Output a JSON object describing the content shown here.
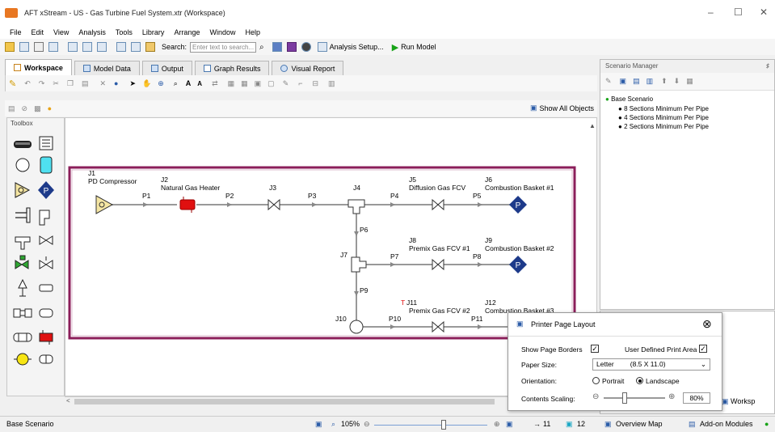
{
  "window": {
    "title": "AFT xStream - US - Gas Turbine Fuel System.xtr (Workspace)",
    "minimize": "–",
    "maximize": "☐",
    "close": "✕"
  },
  "menu": [
    "File",
    "Edit",
    "View",
    "Analysis",
    "Tools",
    "Library",
    "Arrange",
    "Window",
    "Help"
  ],
  "toolbar": {
    "search_label": "Search:",
    "search_placeholder": "Enter text to search...",
    "analysis_setup": "Analysis Setup...",
    "run_model": "Run Model"
  },
  "tabs": [
    "Workspace",
    "Model Data",
    "Output",
    "Graph Results",
    "Visual Report"
  ],
  "workspace": {
    "show_all": "Show All Objects",
    "toolbox_label": "Toolbox"
  },
  "model": {
    "junctions": {
      "j1": {
        "id": "J1",
        "name": "PD Compressor"
      },
      "j2": {
        "id": "J2",
        "name": "Natural Gas Heater"
      },
      "j3": {
        "id": "J3"
      },
      "j4": {
        "id": "J4"
      },
      "j5": {
        "id": "J5",
        "name": "Diffusion Gas FCV"
      },
      "j6": {
        "id": "J6",
        "name": "Combustion Basket #1"
      },
      "j7": {
        "id": "J7"
      },
      "j8": {
        "id": "J8",
        "name": "Premix Gas FCV #1"
      },
      "j9": {
        "id": "J9",
        "name": "Combustion Basket #2"
      },
      "j10": {
        "id": "J10"
      },
      "j11": {
        "id": "J11",
        "name": "Premix Gas FCV #2"
      },
      "j12": {
        "id": "J12",
        "name": "Combustion Basket #3"
      }
    },
    "pipes": [
      "P1",
      "P2",
      "P3",
      "P4",
      "P5",
      "P6",
      "P7",
      "P8",
      "P9",
      "P10",
      "P11"
    ],
    "pump_symbol": "P",
    "warn_marker": "T"
  },
  "scenario": {
    "header": "Scenario Manager",
    "pin": "♯",
    "base": "Base Scenario",
    "children": [
      "8 Sections Minimum Per Pipe",
      "4 Sections Minimum Per Pipe",
      "2 Sections Minimum Per Pipe"
    ]
  },
  "printer": {
    "title": "Printer Page Layout",
    "show_borders": "Show Page Borders",
    "user_defined": "User Defined Print Area",
    "paper_size_label": "Paper Size:",
    "paper_size_value": "Letter",
    "paper_size_dims": "(8.5 X 11.0)",
    "orientation_label": "Orientation:",
    "portrait": "Portrait",
    "landscape": "Landscape",
    "scaling_label": "Contents Scaling:",
    "scaling_value": "80%",
    "check": "✓"
  },
  "status": {
    "scenario": "Base Scenario",
    "zoom": "105%",
    "pipes_count": "11",
    "junctions_count": "12",
    "overview_map": "Overview Map",
    "addon": "Add-on Modules",
    "workspace_tab": "Worksp"
  },
  "colors": {
    "accent": "#1f4e8c",
    "pump": "#1d3a8a",
    "heater": "#e01010",
    "border": "#8b1e5a",
    "compressor": "#f5e6a3"
  }
}
